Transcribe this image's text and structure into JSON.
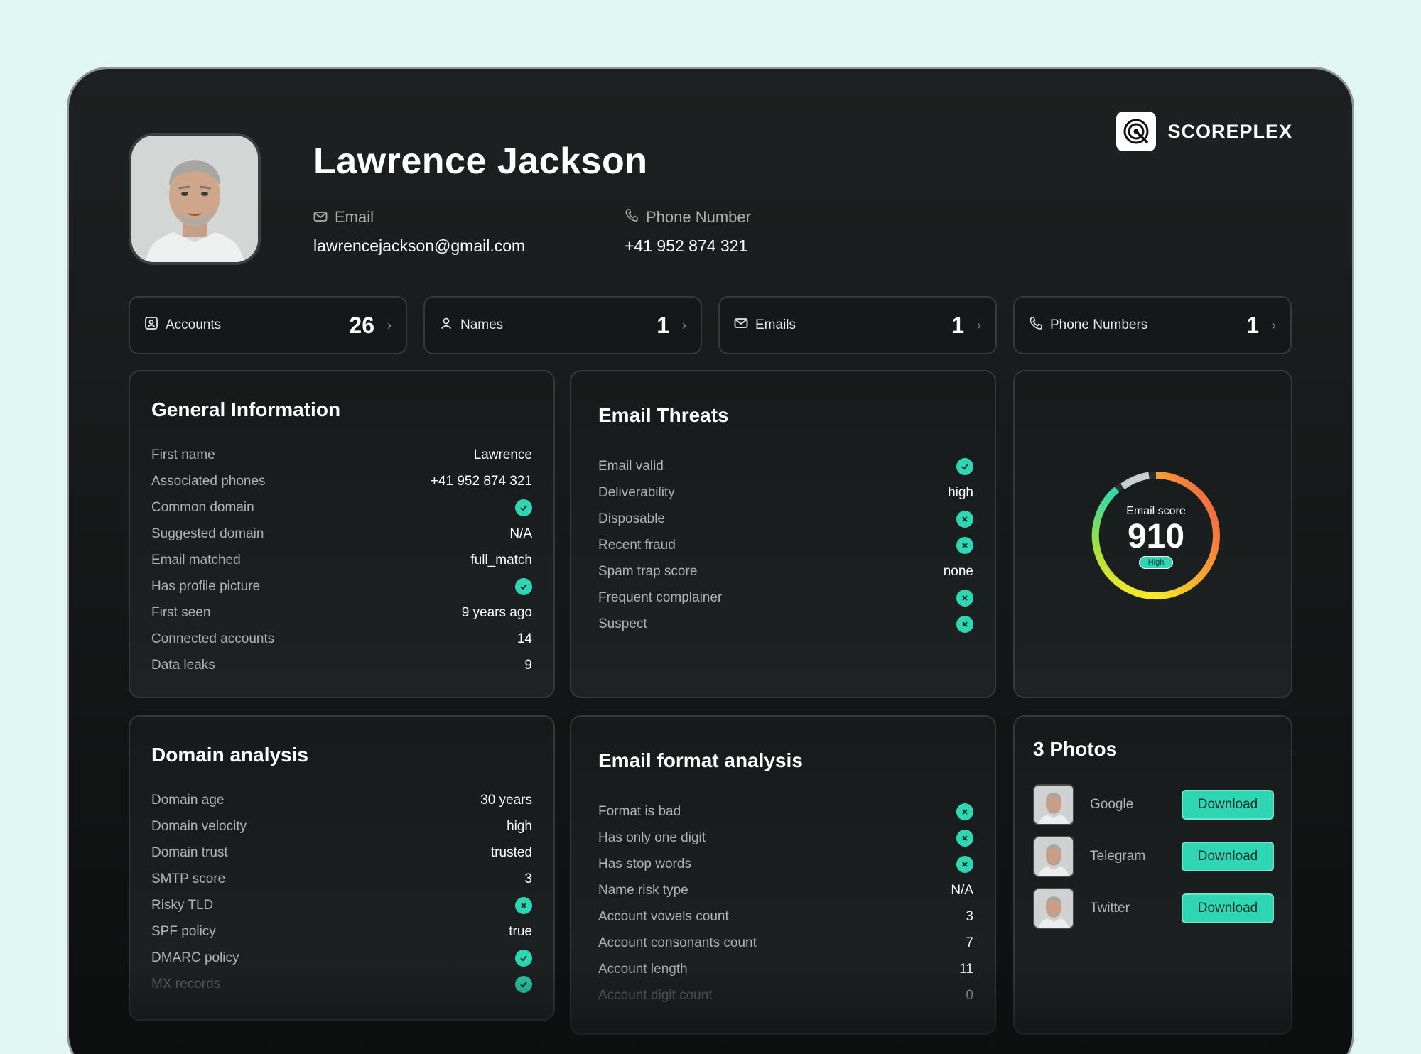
{
  "profile": {
    "name": "Lawrence Jackson",
    "email_label": "Email",
    "email": "lawrencejackson@gmail.com",
    "phone_label": "Phone Number",
    "phone": "+41 952 874 321"
  },
  "brand": {
    "name": "SCOREPLEX"
  },
  "stats": [
    {
      "label": "Accounts",
      "value": "26",
      "icon": "id-card-icon"
    },
    {
      "label": "Names",
      "value": "1",
      "icon": "user-icon"
    },
    {
      "label": "Emails",
      "value": "1",
      "icon": "mail-icon"
    },
    {
      "label": "Phone Numbers",
      "value": "1",
      "icon": "phone-icon"
    }
  ],
  "general": {
    "title": "General Information",
    "rows": [
      {
        "key": "First name",
        "value": "Lawrence"
      },
      {
        "key": "Associated phones",
        "value": "+41 952 874 321"
      },
      {
        "key": "Common domain",
        "icon": "check-icon"
      },
      {
        "key": "Suggested domain",
        "value": "N/A"
      },
      {
        "key": "Email matched",
        "value": "full_match"
      },
      {
        "key": "Has profile picture",
        "icon": "check-icon"
      },
      {
        "key": "First seen",
        "value": "9 years ago"
      },
      {
        "key": "Connected accounts",
        "value": "14"
      },
      {
        "key": "Data leaks",
        "value": "9"
      }
    ]
  },
  "threats": {
    "title": "Email Threats",
    "rows": [
      {
        "key": "Email valid",
        "icon": "check-icon"
      },
      {
        "key": "Deliverability",
        "value": "high"
      },
      {
        "key": "Disposable",
        "icon": "x-icon"
      },
      {
        "key": "Recent fraud",
        "icon": "x-icon"
      },
      {
        "key": "Spam trap score",
        "value": "none"
      },
      {
        "key": "Frequent complainer",
        "icon": "x-icon"
      },
      {
        "key": "Suspect",
        "icon": "x-icon"
      }
    ]
  },
  "score": {
    "label": "Email score",
    "value": "910",
    "badge": "High",
    "level": 0.91
  },
  "domain": {
    "title": "Domain analysis",
    "rows": [
      {
        "key": "Domain age",
        "value": "30 years"
      },
      {
        "key": "Domain velocity",
        "value": "high"
      },
      {
        "key": "Domain trust",
        "value": "trusted"
      },
      {
        "key": "SMTP score",
        "value": "3"
      },
      {
        "key": "Risky TLD",
        "icon": "x-icon"
      },
      {
        "key": "SPF policy",
        "value": "true"
      },
      {
        "key": "DMARC policy",
        "icon": "check-icon"
      },
      {
        "key": "MX records",
        "icon": "check-icon"
      }
    ]
  },
  "format": {
    "title": "Email format analysis",
    "rows": [
      {
        "key": "Format is bad",
        "icon": "x-icon"
      },
      {
        "key": "Has only one digit",
        "icon": "x-icon"
      },
      {
        "key": "Has stop words",
        "icon": "x-icon"
      },
      {
        "key": "Name risk type",
        "value": "N/A"
      },
      {
        "key": "Account vowels count",
        "value": "3"
      },
      {
        "key": "Account consonants count",
        "value": "7"
      },
      {
        "key": "Account length",
        "value": "11"
      },
      {
        "key": "Account digit count",
        "value": "0"
      }
    ]
  },
  "photos": {
    "title": "3 Photos",
    "download_label": "Download",
    "items": [
      {
        "source": "Google"
      },
      {
        "source": "Telegram"
      },
      {
        "source": "Twitter"
      }
    ]
  },
  "colors": {
    "accent": "#2fd6b3",
    "background": "#e0f7f3",
    "panel": "#0d0f0f"
  }
}
